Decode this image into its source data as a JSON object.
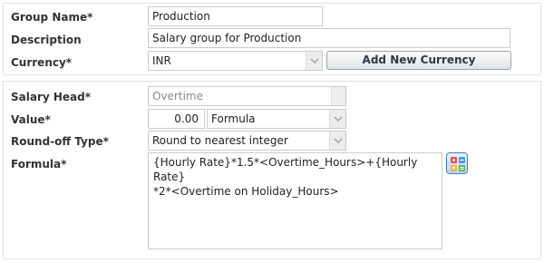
{
  "group": {
    "name_label": "Group Name*",
    "name_value": "Production",
    "description_label": "Description",
    "description_value": "Salary group for Production",
    "currency_label": "Currency*",
    "currency_value": "INR",
    "add_currency_label": "Add New Currency"
  },
  "salary_head": {
    "head_label": "Salary Head*",
    "head_value": "Overtime",
    "value_label": "Value*",
    "value_amount": "0.00",
    "value_type": "Formula",
    "roundoff_label": "Round-off Type*",
    "roundoff_value": "Round to nearest integer",
    "formula_label": "Formula*",
    "formula_value": "{Hourly Rate}*1.5*<Overtime_Hours>+{Hourly Rate}\n*2*<Overtime on Holiday_Hours>",
    "formula_builder_icon": "calculator-icon"
  },
  "colors": {
    "border": "#c7cdd2",
    "panel_border": "#dfe3e6",
    "label": "#333333",
    "button_text": "#2e3a46"
  }
}
